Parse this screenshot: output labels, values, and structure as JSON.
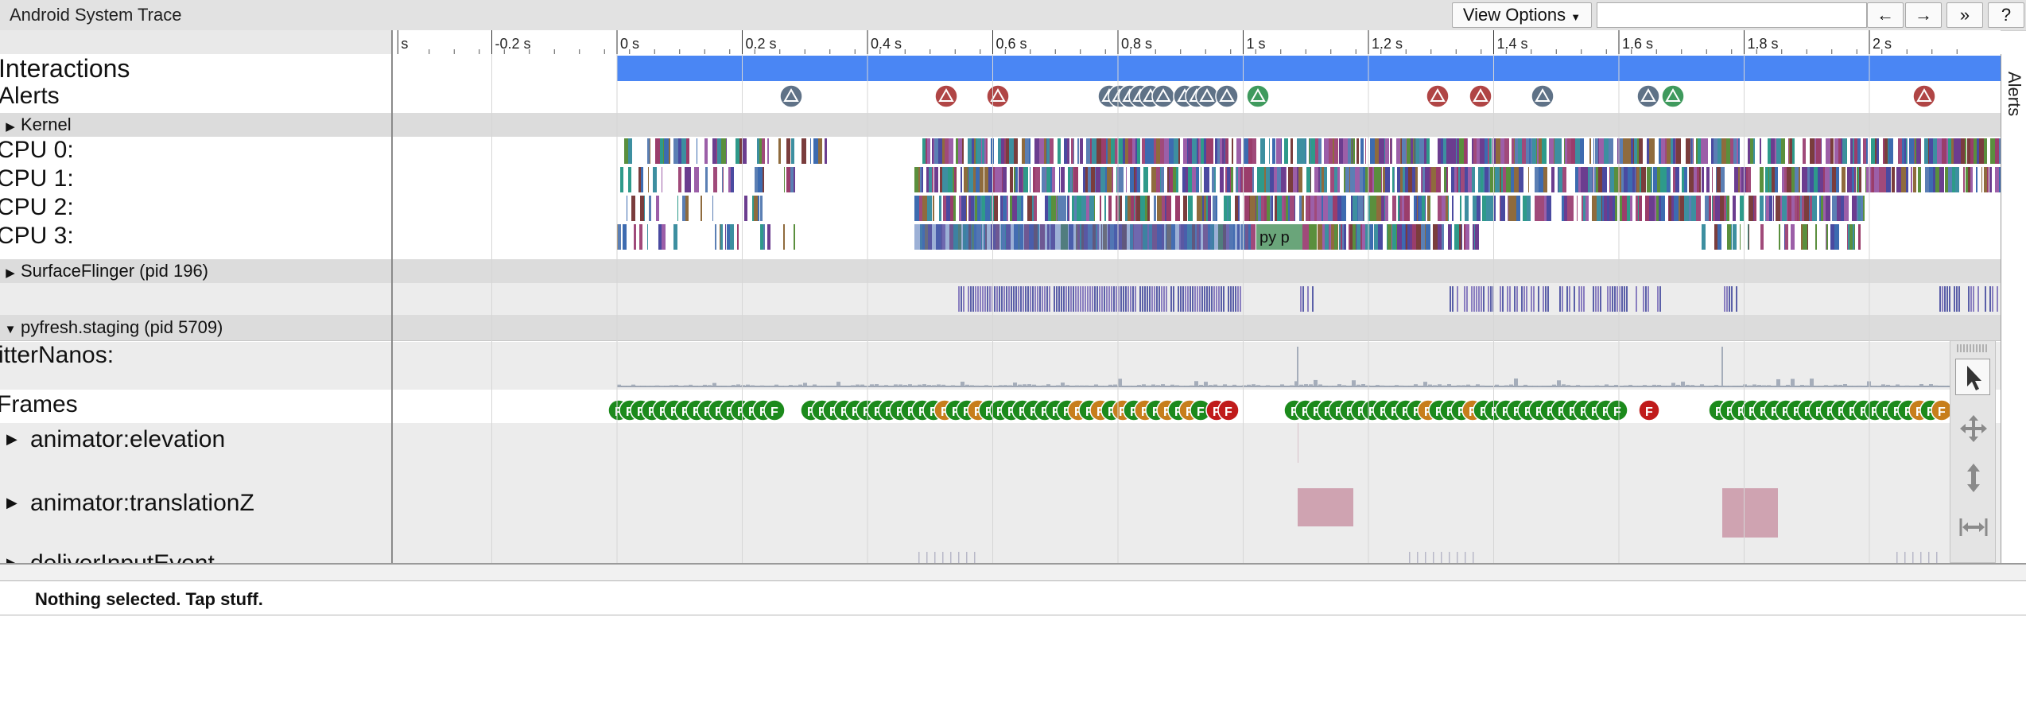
{
  "app": {
    "title": "Android System Trace"
  },
  "toolbar": {
    "view_options_label": "View Options",
    "view_options_icon": "caret-down-icon",
    "search_value": "",
    "prev_icon": "←",
    "next_icon": "→",
    "expand_icon": "»",
    "help_label": "?"
  },
  "ruler": {
    "ticks": [
      "s",
      "-0.2 s",
      "0 s",
      "0.2 s",
      "0.4 s",
      "0.6 s",
      "0.8 s",
      "1 s",
      "1.2 s",
      "1.4 s",
      "1.6 s",
      "1.8 s",
      "2 s"
    ]
  },
  "tracks": {
    "interactions": "Interactions",
    "alerts": "Alerts",
    "kernel": "Kernel",
    "cpu": [
      "CPU 0:",
      "CPU 1:",
      "CPU 2:",
      "CPU 3:"
    ],
    "cpu3_slice_label": "py p",
    "surfaceflinger": "SurfaceFlinger (pid 196)",
    "pyfresh": "pyfresh.staging (pid 5709)",
    "jitter": "itterNanos:",
    "frames": "Frames",
    "frame_glyph": "F",
    "anim_elevation": "animator:elevation",
    "anim_translation": "animator:translationZ",
    "deliver_input": "deliverInputEvent"
  },
  "side_panel": {
    "label": "Alerts"
  },
  "tools": [
    "select-tool-icon",
    "pan-tool-icon",
    "zoom-tool-icon",
    "timing-tool-icon"
  ],
  "status": {
    "text": "Nothing selected. Tap stuff."
  },
  "colors": {
    "interaction_bar": "#4a86f4",
    "alert_red": "#b04545",
    "alert_gray": "#5f7287",
    "alert_green": "#3f9a5d",
    "frame_green": "#1c8a1c",
    "frame_orange": "#c77e1c",
    "frame_red": "#c01b1b",
    "animator_block": "#cfa3b1"
  }
}
